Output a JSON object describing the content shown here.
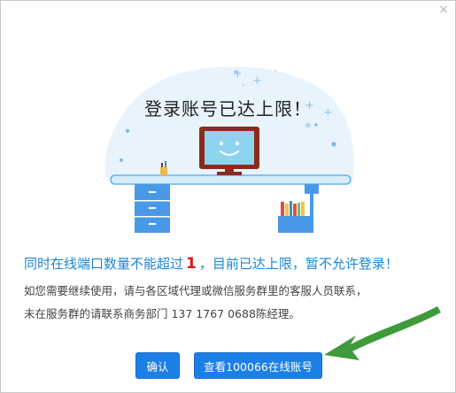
{
  "dialog": {
    "close_glyph": "×",
    "title": "登录账号已达上限！",
    "message": {
      "prefix": "同时在线端口数量不能超过",
      "limit": "1",
      "suffix": "，目前已达上限，暂不允许登录！"
    },
    "contact_line1": "如您需要继续使用，请与各区域代理或微信服务群里的客服人员联系，",
    "contact_line2": "未在服务群的请联系商务部门 137 1767 0688陈经理。",
    "buttons": {
      "ok_label": "确认",
      "view_label": "查看100066在线账号"
    }
  },
  "colors": {
    "accent": "#1c7fe6",
    "message_text": "#1a86d6",
    "limit_number": "#e01515",
    "arrow": "#3e9a3a"
  },
  "icons": [
    "close-icon",
    "monitor-smile-icon",
    "desk-drawer-icon",
    "pencil-holder-icon",
    "books-icon",
    "sparkle-icon",
    "arrow-pointer-icon"
  ]
}
